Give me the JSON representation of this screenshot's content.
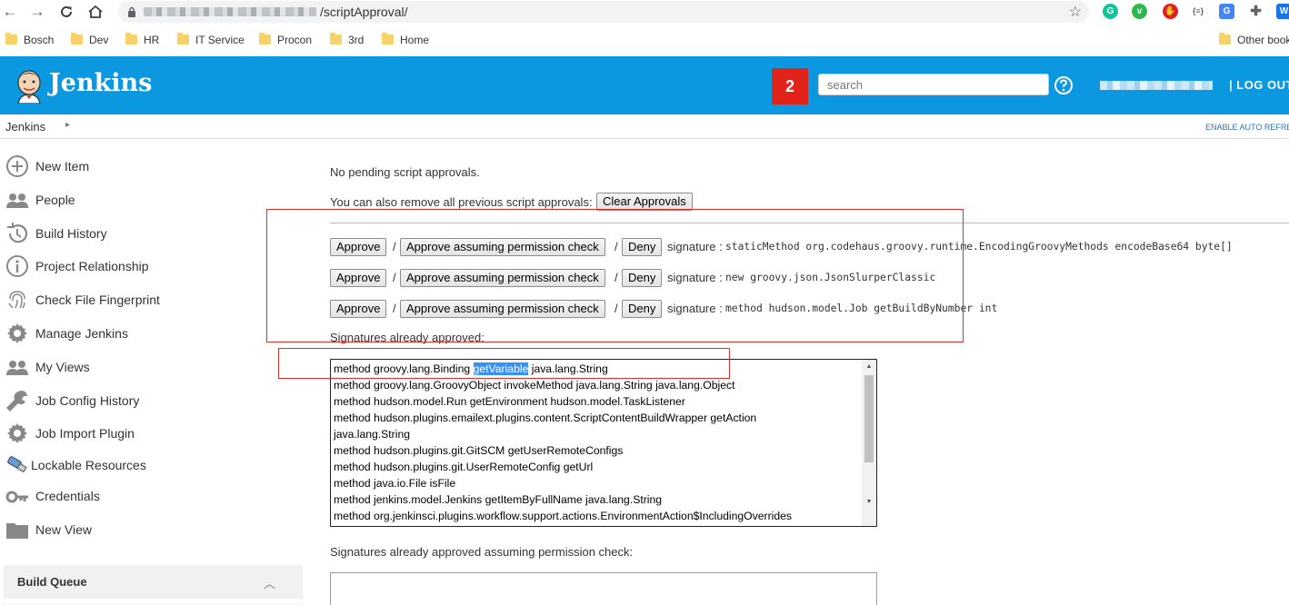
{
  "browser": {
    "url_visible": "/scriptApproval/",
    "extensions": [
      {
        "name": "grammarly-icon",
        "letter": "G",
        "color": "#15c39a"
      },
      {
        "name": "vimium-icon",
        "letter": "v",
        "color": "#2db84d"
      },
      {
        "name": "adblock-icon",
        "letter": "✋",
        "color": "#e02020"
      },
      {
        "name": "json-formatter-icon",
        "letter": "{≡}",
        "color": "#ffffff"
      },
      {
        "name": "translate-icon",
        "letter": "G",
        "color": "#4285f4"
      },
      {
        "name": "extensions-icon",
        "letter": "",
        "color": "#5f6368"
      }
    ],
    "bookmarks": [
      "Bosch",
      "Dev",
      "HR",
      "IT Service",
      "Procon",
      "3rd",
      "Home"
    ],
    "other_bookmarks": "Other book"
  },
  "header": {
    "brand": "Jenkins",
    "notifications": "2",
    "search_placeholder": "search",
    "logout": "| LOG OUT",
    "color": "#0c98e0"
  },
  "breadcrumb": {
    "root": "Jenkins",
    "auto_refresh": "ENABLE AUTO REFRESH"
  },
  "sidebar": {
    "items": [
      {
        "label": "New Item",
        "icon": "add-circle-icon"
      },
      {
        "label": "People",
        "icon": "people-icon"
      },
      {
        "label": "Build History",
        "icon": "history-icon"
      },
      {
        "label": "Project Relationship",
        "icon": "info-icon"
      },
      {
        "label": "Check File Fingerprint",
        "icon": "fingerprint-icon"
      },
      {
        "label": "Manage Jenkins",
        "icon": "gear-icon"
      },
      {
        "label": "My Views",
        "icon": "people-icon"
      },
      {
        "label": "Job Config History",
        "icon": "wrench-icon"
      },
      {
        "label": "Job Import Plugin",
        "icon": "gear-icon"
      },
      {
        "label": "Lockable Resources",
        "icon": "usb-icon"
      },
      {
        "label": "Credentials",
        "icon": "key-icon"
      },
      {
        "label": "New View",
        "icon": "folder-icon"
      }
    ],
    "build_queue": "Build Queue"
  },
  "main": {
    "no_pending": "No pending script approvals.",
    "remove_text": "You can also remove all previous script approvals:",
    "clear_button": "Clear Approvals",
    "approve_label": "Approve",
    "approve_perm_label": "Approve assuming permission check",
    "deny_label": "Deny",
    "separator": "/",
    "signature_label": "signature :",
    "pending": [
      {
        "signature": "staticMethod org.codehaus.groovy.runtime.EncodingGroovyMethods encodeBase64 byte[]"
      },
      {
        "signature": "new groovy.json.JsonSlurperClassic"
      },
      {
        "signature": "method hudson.model.Job getBuildByNumber int"
      }
    ],
    "approved_heading": "Signatures already approved:",
    "approved_line1_pre": "method groovy.lang.Binding ",
    "approved_line1_hl": "getVariable",
    "approved_line1_post": " java.lang.String",
    "approved_lines": [
      "method groovy.lang.GroovyObject invokeMethod java.lang.String java.lang.Object",
      "method hudson.model.Run getEnvironment hudson.model.TaskListener",
      "method hudson.plugins.emailext.plugins.content.ScriptContentBuildWrapper getAction",
      "java.lang.String",
      "method hudson.plugins.git.GitSCM getUserRemoteConfigs",
      "method hudson.plugins.git.UserRemoteConfig getUrl",
      "method java.io.File isFile",
      "method jenkins.model.Jenkins getItemByFullName java.lang.String",
      "method org.jenkinsci.plugins.workflow.support.actions.EnvironmentAction$IncludingOverrides"
    ],
    "approved_perm_heading": "Signatures already approved assuming permission check:"
  }
}
